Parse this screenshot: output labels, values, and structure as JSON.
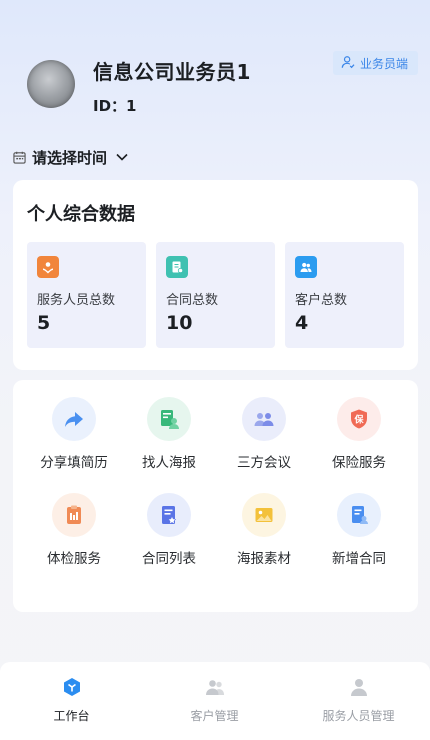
{
  "header": {
    "company_name": "信息公司业务员1",
    "user_id": "ID：1",
    "role_badge": "业务员端"
  },
  "filter": {
    "time_label": "请选择时间"
  },
  "stats": {
    "title": "个人综合数据",
    "items": [
      {
        "label": "服务人员总数",
        "value": "5",
        "icon": "service-staff-icon",
        "color": "#f1853b"
      },
      {
        "label": "合同总数",
        "value": "10",
        "icon": "contract-icon",
        "color": "#3fc1b1"
      },
      {
        "label": "客户总数",
        "value": "4",
        "icon": "customers-icon",
        "color": "#2b9cf0"
      }
    ]
  },
  "grid": {
    "items": [
      {
        "label": "分享填简历",
        "icon": "share-arrow-icon",
        "color": "#4a90f0"
      },
      {
        "label": "找人海报",
        "icon": "poster-person-icon",
        "color": "#37b87a"
      },
      {
        "label": "三方会议",
        "icon": "meeting-icon",
        "color": "#7c8ce8"
      },
      {
        "label": "保险服务",
        "icon": "insurance-icon",
        "color": "#f06a55"
      },
      {
        "label": "体检服务",
        "icon": "checkup-icon",
        "color": "#f08a55"
      },
      {
        "label": "合同列表",
        "icon": "contract-list-icon",
        "color": "#5a74e6"
      },
      {
        "label": "海报素材",
        "icon": "poster-material-icon",
        "color": "#f3c13a"
      },
      {
        "label": "新增合同",
        "icon": "new-contract-icon",
        "color": "#4a8ef0"
      }
    ]
  },
  "tabbar": {
    "items": [
      {
        "label": "工作台",
        "icon": "workbench-icon",
        "active": true
      },
      {
        "label": "客户管理",
        "icon": "customer-manage-icon",
        "active": false
      },
      {
        "label": "服务人员管理",
        "icon": "staff-manage-icon",
        "active": false
      }
    ]
  },
  "colors": {
    "accent": "#3b86e8",
    "badge_bg": "#d9e7fb",
    "stat_bg": "#eef0fb"
  }
}
